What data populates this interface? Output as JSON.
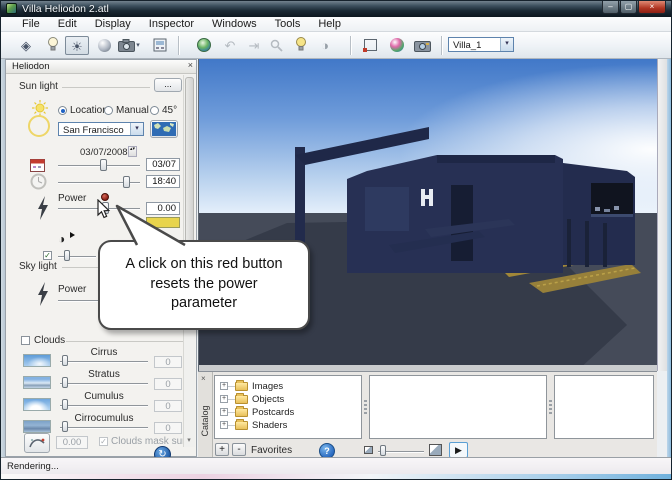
{
  "window": {
    "title": "Villa Heliodon 2.atl",
    "status": "Rendering..."
  },
  "menu": {
    "items": [
      "File",
      "Edit",
      "Display",
      "Inspector",
      "Windows",
      "Tools",
      "Help"
    ]
  },
  "toolbar": {
    "view_selector": "Villa_1"
  },
  "heliodon": {
    "panel_title": "Heliodon",
    "sun_light_label": "Sun light",
    "more_button": "...",
    "radio_location": "Location",
    "radio_manual": "Manual",
    "radio_45": "45°",
    "city": "San Francisco",
    "date_full": "03/07/2008",
    "date_short": "03/07",
    "time": "18:40",
    "power_label": "Power",
    "power_value": "0.00",
    "sky_light_label": "Sky light",
    "sky_power_label": "Power",
    "clouds_label": "Clouds",
    "clouds": [
      {
        "label": "Cirrus",
        "value": "0"
      },
      {
        "label": "Stratus",
        "value": "0"
      },
      {
        "label": "Cumulus",
        "value": "0"
      },
      {
        "label": "Cirrocumulus",
        "value": "0"
      }
    ],
    "wind_value": "0.00",
    "mask_label": "Clouds mask sun"
  },
  "bubble": {
    "text": "A click on this red button\nresets the power\nparameter"
  },
  "catalog": {
    "tab": "Catalog",
    "folders": [
      "Images",
      "Objects",
      "Postcards",
      "Shaders"
    ],
    "favorites": "Favorites"
  },
  "icons": {
    "close": "×",
    "minimize": "–",
    "maximize": "▢",
    "dropdown": "▾",
    "spin_up": "▴",
    "spin_down": "▾",
    "check": "✓",
    "plus": "+",
    "minus": "-",
    "help": "?",
    "play": "▶",
    "shaders": "◈",
    "sun": "☀",
    "undo": "↶",
    "insert": "⇥",
    "gradient": "◑",
    "refresh": "↻"
  },
  "colors": {
    "sky_top": "#4178c8",
    "sky_horizon": "#e6f0fb",
    "ground": "#454b59",
    "villa": "#273054",
    "terrain": "#a18738",
    "power_swatch": "#e8d44d",
    "red_button": "#9c2f2a",
    "title_bar": "#1b2a35",
    "accent_blue": "#2a6ac0"
  }
}
